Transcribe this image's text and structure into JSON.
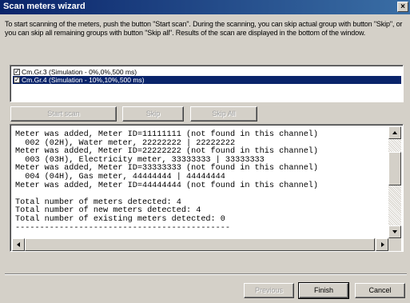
{
  "window": {
    "title": "Scan meters wizard",
    "close_glyph": "×"
  },
  "instructions": "To start scanning of the meters, push the button \"Start scan\". During the scanning, you can skip actual group with button \"Skip\", or you can skip all remaining groups with button \"Skip all\". Results of the scan are displayed in the bottom of the window.",
  "groups": [
    {
      "label": "Cm.Gr.3 (Simulation - 0%,0%,500 ms)",
      "checked": true,
      "selected": false
    },
    {
      "label": "Cm.Gr.4 (Simulation - 10%,10%,500 ms)",
      "checked": true,
      "selected": true
    }
  ],
  "scan_buttons": {
    "start": "Start scan",
    "skip": "Skip",
    "skip_all": "Skip All"
  },
  "log": [
    "Meter was added, Meter ID=11111111 (not found in this channel)",
    "  002 (02H), Water meter, 22222222 | 22222222",
    "Meter was added, Meter ID=22222222 (not found in this channel)",
    "  003 (03H), Electricity meter, 33333333 | 33333333",
    "Meter was added, Meter ID=33333333 (not found in this channel)",
    "  004 (04H), Gas meter, 44444444 | 44444444",
    "Meter was added, Meter ID=44444444 (not found in this channel)",
    "",
    "Total number of meters detected: 4",
    "Total number of new meters detected: 4",
    "Total number of existing meters detected: 0",
    "--------------------------------------------"
  ],
  "footer": {
    "previous": "Previous",
    "finish": "Finish",
    "cancel": "Cancel"
  },
  "icons": {
    "checkbox": "✓"
  },
  "colors": {
    "title_start": "#0a246a",
    "title_end": "#3a6ea5",
    "selection": "#0a246a",
    "face": "#d4d0c8"
  }
}
